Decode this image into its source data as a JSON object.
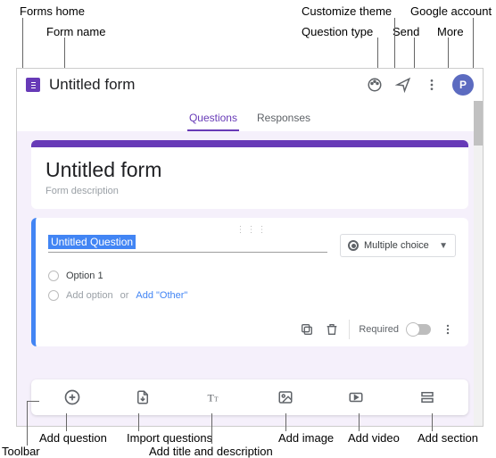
{
  "annotations": {
    "forms_home": "Forms home",
    "form_name": "Form name",
    "customize_theme": "Customize theme",
    "question_type": "Question type",
    "google_account": "Google account",
    "send": "Send",
    "more": "More",
    "add_question": "Add question",
    "import_questions": "Import questions",
    "add_title_desc": "Add title and description",
    "add_image": "Add image",
    "add_video": "Add video",
    "add_section": "Add section",
    "toolbar": "Toolbar"
  },
  "topbar": {
    "form_name": "Untitled form",
    "avatar_initial": "P"
  },
  "tabs": {
    "questions": "Questions",
    "responses": "Responses"
  },
  "header_card": {
    "title": "Untitled form",
    "description": "Form description"
  },
  "question": {
    "title": "Untitled Question",
    "type_label": "Multiple choice",
    "option1": "Option 1",
    "add_option": "Add option",
    "or": "or",
    "add_other": "Add \"Other\"",
    "required": "Required"
  }
}
